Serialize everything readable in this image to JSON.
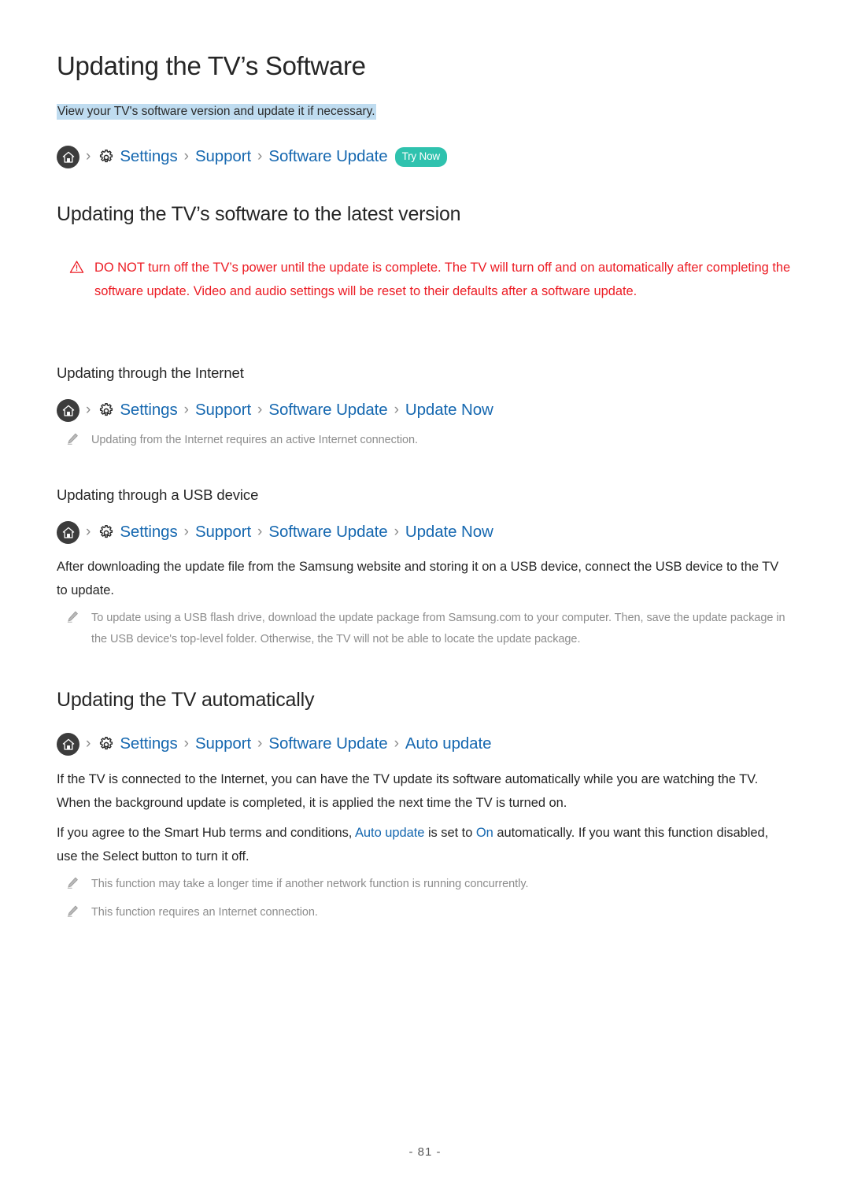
{
  "document": {
    "title": "Updating the TV’s Software",
    "subtitle": "View your TV's software version and update it if necessary.",
    "page_number": "- 81 -"
  },
  "colors": {
    "link": "#1668b0",
    "warning": "#ec1c24",
    "badge": "#2fc2ae",
    "highlight": "#bfdcf0",
    "note": "#8c8c8c",
    "heading": "#262626"
  },
  "breadcrumbs": {
    "main": {
      "home_icon": "home-icon",
      "gear_icon": "gear-icon",
      "separator": "›",
      "items": [
        "Settings",
        "Support",
        "Software Update"
      ],
      "badge": "Try Now"
    },
    "internet": {
      "items": [
        "Settings",
        "Support",
        "Software Update",
        "Update Now"
      ]
    },
    "usb": {
      "items": [
        "Settings",
        "Support",
        "Software Update",
        "Update Now"
      ]
    },
    "auto": {
      "items": [
        "Settings",
        "Support",
        "Software Update",
        "Auto update"
      ]
    }
  },
  "sections": {
    "latest_version": {
      "heading": "Updating the TV’s software to the latest version",
      "warning_icon": "warning-triangle-icon",
      "warning": "DO NOT turn off the TV’s power until the update is complete. The TV will turn off and on automatically after completing the software update. Video and audio settings will be reset to their defaults after a software update."
    },
    "internet": {
      "heading": "Updating through the Internet",
      "note_icon": "pencil-icon",
      "note": "Updating from the Internet requires an active Internet connection."
    },
    "usb": {
      "heading": "Updating through a USB device",
      "paragraph": "After downloading the update file from the Samsung website and storing it on a USB device, connect the USB device to the TV to update.",
      "note_icon": "pencil-icon",
      "note": "To update using a USB flash drive, download the update package from Samsung.com to your computer. Then, save the update package in the USB device's top-level folder. Otherwise, the TV will not be able to locate the update package."
    },
    "automatic": {
      "heading": "Updating the TV automatically",
      "paragraph1": "If the TV is connected to the Internet, you can have the TV update its software automatically while you are watching the TV. When the background update is completed, it is applied the next time the TV is turned on.",
      "paragraph2_part1": "If you agree to the Smart Hub terms and conditions, ",
      "paragraph2_link1": "Auto update",
      "paragraph2_part2": " is set to ",
      "paragraph2_link2": "On",
      "paragraph2_part3": " automatically. If you want this function disabled, use the Select button to turn it off.",
      "note1_icon": "pencil-icon",
      "note1": "This function may take a longer time if another network function is running concurrently.",
      "note2_icon": "pencil-icon",
      "note2": "This function requires an Internet connection."
    }
  }
}
